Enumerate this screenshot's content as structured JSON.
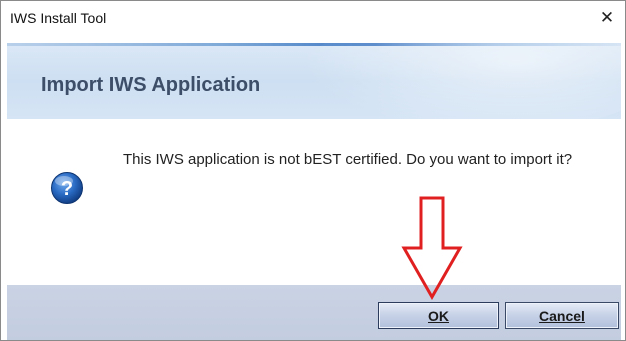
{
  "window": {
    "title": "IWS Install Tool",
    "close_glyph": "✕"
  },
  "banner": {
    "title": "Import IWS Application"
  },
  "dialog": {
    "icon": "question-icon",
    "message": "This IWS application is not bEST certified. Do you want to import it?"
  },
  "buttons": {
    "ok_label": "OK",
    "cancel_label": "Cancel"
  },
  "annotation": {
    "arrow": "down-arrow-icon",
    "arrow_color": "#e02020"
  },
  "colors": {
    "banner_bg": "#d3e3f4",
    "banner_title": "#3c4e68",
    "footer_bg": "#c6d0e2",
    "button_border": "#2b3c5c",
    "question_icon": "#1f5fb4"
  }
}
